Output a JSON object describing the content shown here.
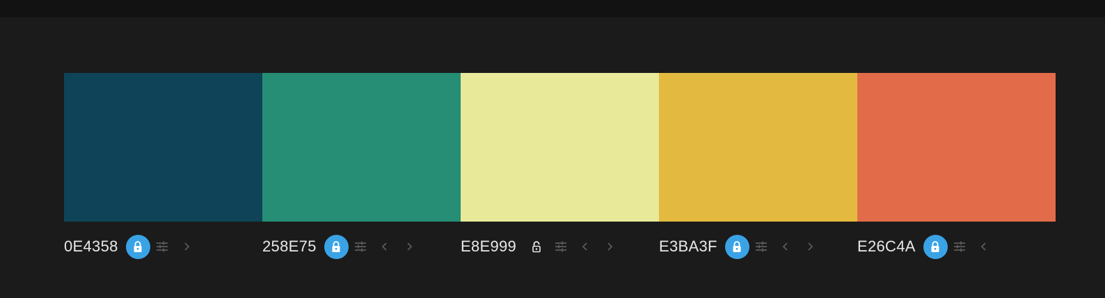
{
  "colors": {
    "background": "#1b1b1b",
    "topbar": "#121212",
    "accent": "#3aa3e6",
    "muted_icon": "#5a5a5a"
  },
  "palette": [
    {
      "hex": "0E4358",
      "color": "#0E4358",
      "locked": true,
      "icons": [
        "lock-icon",
        "sliders-icon",
        "chevron-right-icon"
      ]
    },
    {
      "hex": "258E75",
      "color": "#258E75",
      "locked": true,
      "icons": [
        "lock-icon",
        "sliders-icon",
        "chevron-left-icon",
        "chevron-right-icon"
      ]
    },
    {
      "hex": "E8E999",
      "color": "#E8E999",
      "locked": false,
      "icons": [
        "unlock-icon",
        "sliders-icon",
        "chevron-left-icon",
        "chevron-right-icon"
      ]
    },
    {
      "hex": "E3BA3F",
      "color": "#E3BA3F",
      "locked": true,
      "icons": [
        "lock-icon",
        "sliders-icon",
        "chevron-left-icon",
        "chevron-right-icon"
      ]
    },
    {
      "hex": "E26C4A",
      "color": "#E26C4A",
      "locked": true,
      "icons": [
        "lock-icon",
        "sliders-icon",
        "chevron-left-icon"
      ]
    }
  ]
}
